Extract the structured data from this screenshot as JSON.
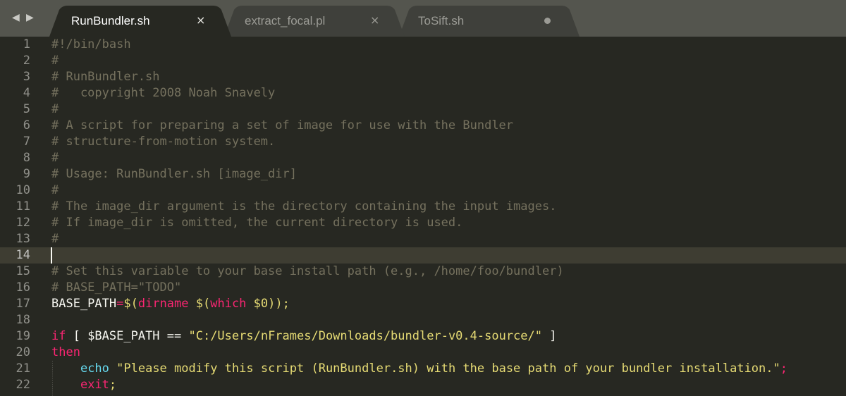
{
  "colors": {
    "background": "#272822",
    "tabbar": "#54554e",
    "active_tab": "#272822",
    "inactive_tab": "#3f403b",
    "comment": "#75715e",
    "keyword": "#f92672",
    "builtin": "#66d9ef",
    "string": "#e6db74",
    "number": "#ae81ff",
    "text": "#f8f8f2",
    "gutter": "#90908a",
    "current_line": "#3e3d32"
  },
  "navigation": {
    "back_icon": "triangle-left",
    "forward_icon": "triangle-right"
  },
  "tabs": [
    {
      "label": "RunBundler.sh",
      "active": true,
      "close_icon": "×"
    },
    {
      "label": "extract_focal.pl",
      "active": false,
      "close_icon": "×"
    },
    {
      "label": "ToSift.sh",
      "active": false,
      "modified_icon": "dot"
    }
  ],
  "editor": {
    "current_line": 14,
    "lines": [
      {
        "number": "1",
        "tokens": [
          {
            "text": "#!/bin/bash",
            "type": "comment"
          }
        ]
      },
      {
        "number": "2",
        "tokens": [
          {
            "text": "#",
            "type": "comment"
          }
        ]
      },
      {
        "number": "3",
        "tokens": [
          {
            "text": "# RunBundler.sh",
            "type": "comment"
          }
        ]
      },
      {
        "number": "4",
        "tokens": [
          {
            "text": "#   copyright 2008 Noah Snavely",
            "type": "comment"
          }
        ]
      },
      {
        "number": "5",
        "tokens": [
          {
            "text": "#",
            "type": "comment"
          }
        ]
      },
      {
        "number": "6",
        "tokens": [
          {
            "text": "# A script for preparing a set of image for use with the Bundler",
            "type": "comment"
          }
        ]
      },
      {
        "number": "7",
        "tokens": [
          {
            "text": "# structure-from-motion system.",
            "type": "comment"
          }
        ]
      },
      {
        "number": "8",
        "tokens": [
          {
            "text": "#",
            "type": "comment"
          }
        ]
      },
      {
        "number": "9",
        "tokens": [
          {
            "text": "# Usage: RunBundler.sh [image_dir]",
            "type": "comment"
          }
        ]
      },
      {
        "number": "10",
        "tokens": [
          {
            "text": "#",
            "type": "comment"
          }
        ]
      },
      {
        "number": "11",
        "tokens": [
          {
            "text": "# The image_dir argument is the directory containing the input images.",
            "type": "comment"
          }
        ]
      },
      {
        "number": "12",
        "tokens": [
          {
            "text": "# If image_dir is omitted, the current directory is used.",
            "type": "comment"
          }
        ]
      },
      {
        "number": "13",
        "tokens": [
          {
            "text": "#",
            "type": "comment"
          }
        ]
      },
      {
        "number": "14",
        "tokens": []
      },
      {
        "number": "15",
        "tokens": [
          {
            "text": "# Set this variable to your base install path (e.g., /home/foo/bundler)",
            "type": "comment"
          }
        ]
      },
      {
        "number": "16",
        "tokens": [
          {
            "text": "# BASE_PATH=\"TODO\"",
            "type": "comment"
          }
        ]
      },
      {
        "number": "17",
        "tokens": [
          {
            "text": "BASE_PATH",
            "type": "text"
          },
          {
            "text": "=",
            "type": "keyword"
          },
          {
            "text": "$(",
            "type": "string"
          },
          {
            "text": "dirname",
            "type": "keyword"
          },
          {
            "text": " $(",
            "type": "string"
          },
          {
            "text": "which",
            "type": "keyword"
          },
          {
            "text": " $0));",
            "type": "string"
          }
        ]
      },
      {
        "number": "18",
        "tokens": []
      },
      {
        "number": "19",
        "tokens": [
          {
            "text": "if",
            "type": "keyword"
          },
          {
            "text": " [ $BASE_PATH == ",
            "type": "text"
          },
          {
            "text": "\"C:/Users/nFrames/Downloads/bundler-v0.4-source/\"",
            "type": "string"
          },
          {
            "text": " ]",
            "type": "text"
          }
        ]
      },
      {
        "number": "20",
        "tokens": [
          {
            "text": "then",
            "type": "keyword"
          }
        ]
      },
      {
        "number": "21",
        "tokens": [
          {
            "text": "    ",
            "type": "text"
          },
          {
            "text": "echo",
            "type": "builtin"
          },
          {
            "text": " \"Please modify this script (RunBundler.sh) with the base path of your bundler installation.\"",
            "type": "string"
          },
          {
            "text": ";",
            "type": "keyword"
          }
        ]
      },
      {
        "number": "22",
        "tokens": [
          {
            "text": "    ",
            "type": "text"
          },
          {
            "text": "exit",
            "type": "keyword"
          },
          {
            "text": ";",
            "type": "string"
          }
        ]
      }
    ]
  }
}
